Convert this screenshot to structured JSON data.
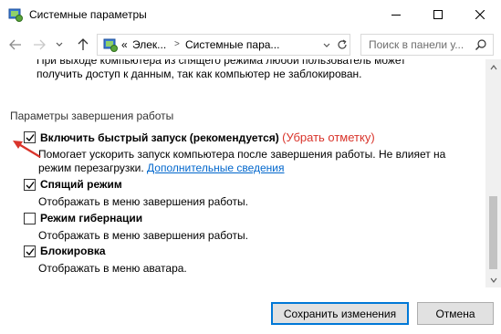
{
  "window": {
    "title": "Системные параметры"
  },
  "nav": {
    "address_crumbs": [
      "Элек...",
      "Системные пара..."
    ],
    "address_prefix": "«",
    "search_placeholder": "Поиск в панели у..."
  },
  "content": {
    "top_text_line1": "При выходе компьютера из спящего режима любой пользователь может",
    "top_text_line2": "получить доступ к данным, так как компьютер не заблокирован.",
    "section_title": "Параметры завершения работы",
    "options": [
      {
        "label": "Включить быстрый запуск (рекомендуется)",
        "annotation": "(Убрать отметку)",
        "desc_line1": "Помогает ускорить запуск компьютера после завершения работы. Не влияет на",
        "desc_line2": "режим перезагрузки.",
        "link": "Дополнительные сведения",
        "checked": true
      },
      {
        "label": "Спящий режим",
        "desc_line1": "Отображать в меню завершения работы.",
        "checked": true
      },
      {
        "label": "Режим гибернации",
        "desc_line1": "Отображать в меню завершения работы.",
        "checked": false
      },
      {
        "label": "Блокировка",
        "desc_line1": "Отображать в меню аватара.",
        "checked": true
      }
    ]
  },
  "footer": {
    "save_label": "Сохранить изменения",
    "cancel_label": "Отмена"
  },
  "colors": {
    "accent": "#0078d7",
    "link": "#0066cc",
    "annotation": "#d9342b"
  }
}
